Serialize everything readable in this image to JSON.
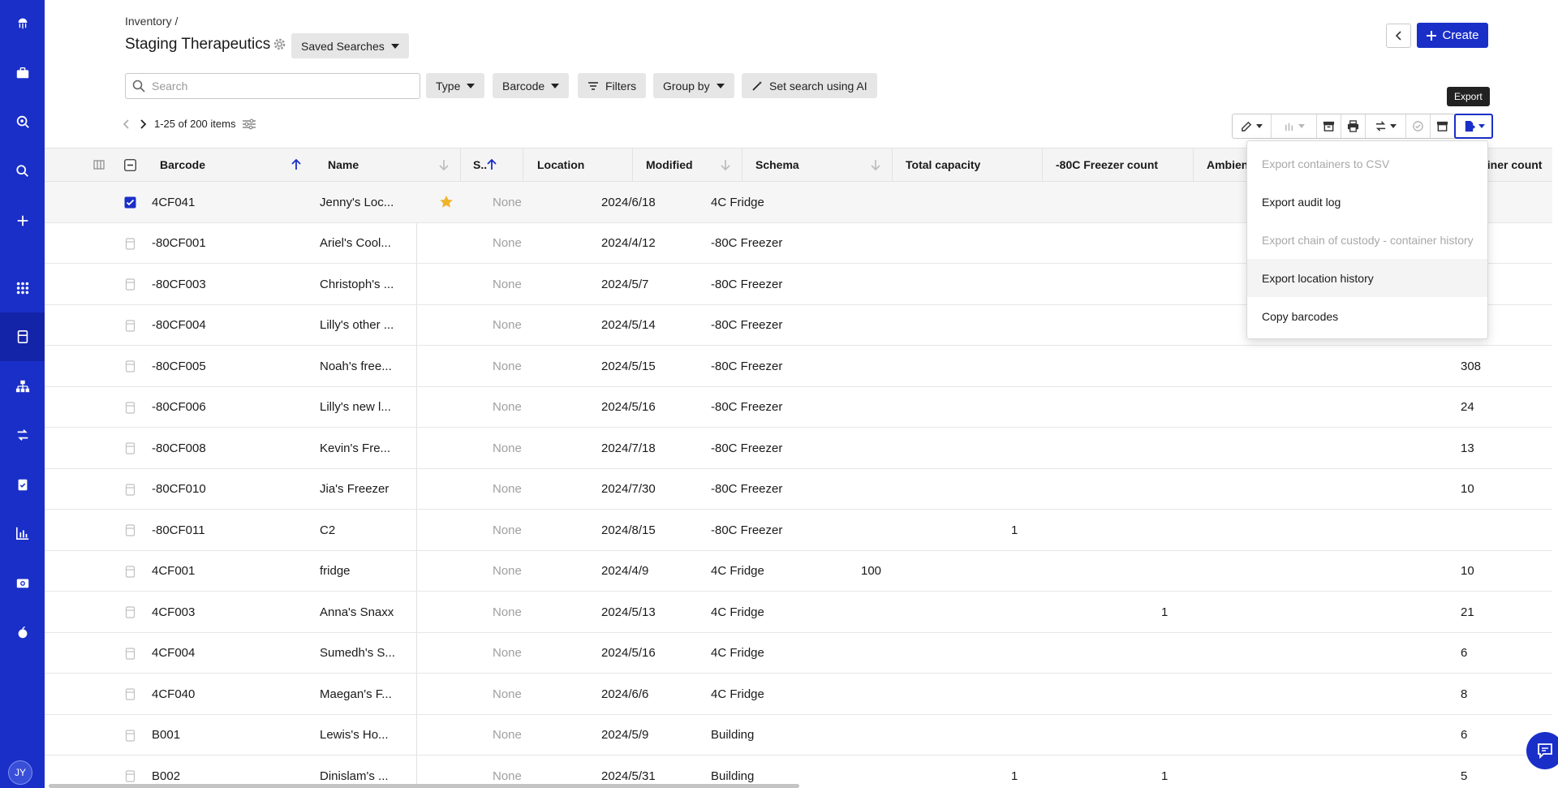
{
  "header": {
    "breadcrumb": "Inventory /",
    "title": "Staging Therapeutics",
    "saved_searches": "Saved Searches",
    "create": "Create"
  },
  "filters": {
    "search_placeholder": "Search",
    "type": "Type",
    "barcode": "Barcode",
    "filters": "Filters",
    "group_by": "Group by",
    "ai": "Set search using AI"
  },
  "pager": {
    "label": "1-25 of 200 items"
  },
  "tooltip": "Export",
  "user": {
    "initials": "JY"
  },
  "colors": {
    "brand": "#1a2fc8",
    "star": "#f0b42a"
  },
  "columns": [
    "Barcode",
    "Name",
    "S..",
    "Location",
    "Modified",
    "Schema",
    "Total capacity",
    "-80C Freezer count",
    "Ambient Bench",
    "ainer count"
  ],
  "rows": [
    {
      "barcode": "4CF041",
      "name": "Jenny's Loc...",
      "star": true,
      "location": "None",
      "modified": "2024/6/18",
      "schema": "4C Fridge",
      "cap": "",
      "f80": "",
      "amb": "",
      "cnt": ""
    },
    {
      "barcode": "-80CF001",
      "name": "Ariel's Cool...",
      "star": false,
      "location": "None",
      "modified": "2024/4/12",
      "schema": "-80C Freezer",
      "cap": "",
      "f80": "",
      "amb": "",
      "cnt": ""
    },
    {
      "barcode": "-80CF003",
      "name": "Christoph's ...",
      "star": false,
      "location": "None",
      "modified": "2024/5/7",
      "schema": "-80C Freezer",
      "cap": "",
      "f80": "",
      "amb": "",
      "cnt": ""
    },
    {
      "barcode": "-80CF004",
      "name": "Lilly's other ...",
      "star": false,
      "location": "None",
      "modified": "2024/5/14",
      "schema": "-80C Freezer",
      "cap": "",
      "f80": "",
      "amb": "",
      "cnt": ""
    },
    {
      "barcode": "-80CF005",
      "name": "Noah's free...",
      "star": false,
      "location": "None",
      "modified": "2024/5/15",
      "schema": "-80C Freezer",
      "cap": "",
      "f80": "",
      "amb": "",
      "cnt": "308"
    },
    {
      "barcode": "-80CF006",
      "name": "Lilly's new l...",
      "star": false,
      "location": "None",
      "modified": "2024/5/16",
      "schema": "-80C Freezer",
      "cap": "",
      "f80": "",
      "amb": "",
      "cnt": "24"
    },
    {
      "barcode": "-80CF008",
      "name": "Kevin's Fre...",
      "star": false,
      "location": "None",
      "modified": "2024/7/18",
      "schema": "-80C Freezer",
      "cap": "",
      "f80": "",
      "amb": "",
      "cnt": "13"
    },
    {
      "barcode": "-80CF010",
      "name": "Jia's Freezer",
      "star": false,
      "location": "None",
      "modified": "2024/7/30",
      "schema": "-80C Freezer",
      "cap": "",
      "f80": "",
      "amb": "",
      "cnt": "10"
    },
    {
      "barcode": "-80CF011",
      "name": "C2",
      "star": false,
      "location": "None",
      "modified": "2024/8/15",
      "schema": "-80C Freezer",
      "cap": "",
      "f80": "1",
      "amb": "",
      "cnt": ""
    },
    {
      "barcode": "4CF001",
      "name": "fridge",
      "star": false,
      "location": "None",
      "modified": "2024/4/9",
      "schema": "4C Fridge",
      "cap": "100",
      "f80": "",
      "amb": "",
      "cnt": "10"
    },
    {
      "barcode": "4CF003",
      "name": "Anna's Snaxx",
      "star": false,
      "location": "None",
      "modified": "2024/5/13",
      "schema": "4C Fridge",
      "cap": "",
      "f80": "",
      "amb": "1",
      "cnt": "21"
    },
    {
      "barcode": "4CF004",
      "name": "Sumedh's S...",
      "star": false,
      "location": "None",
      "modified": "2024/5/16",
      "schema": "4C Fridge",
      "cap": "",
      "f80": "",
      "amb": "",
      "cnt": "6"
    },
    {
      "barcode": "4CF040",
      "name": "Maegan's F...",
      "star": false,
      "location": "None",
      "modified": "2024/6/6",
      "schema": "4C Fridge",
      "cap": "",
      "f80": "",
      "amb": "",
      "cnt": "8"
    },
    {
      "barcode": "B001",
      "name": "Lewis's Ho...",
      "star": false,
      "location": "None",
      "modified": "2024/5/9",
      "schema": "Building",
      "cap": "",
      "f80": "",
      "amb": "",
      "cnt": "6"
    },
    {
      "barcode": "B002",
      "name": "Dinislam's ...",
      "star": false,
      "location": "None",
      "modified": "2024/5/31",
      "schema": "Building",
      "cap": "",
      "f80": "1",
      "amb": "1",
      "cnt": "5"
    }
  ],
  "menu": [
    {
      "label": "Export containers to CSV",
      "disabled": true
    },
    {
      "label": "Export audit log",
      "disabled": false
    },
    {
      "label": "Export chain of custody - container history",
      "disabled": true
    },
    {
      "label": "Export location history",
      "disabled": false,
      "hover": true
    },
    {
      "label": "Copy barcodes",
      "disabled": false
    }
  ]
}
